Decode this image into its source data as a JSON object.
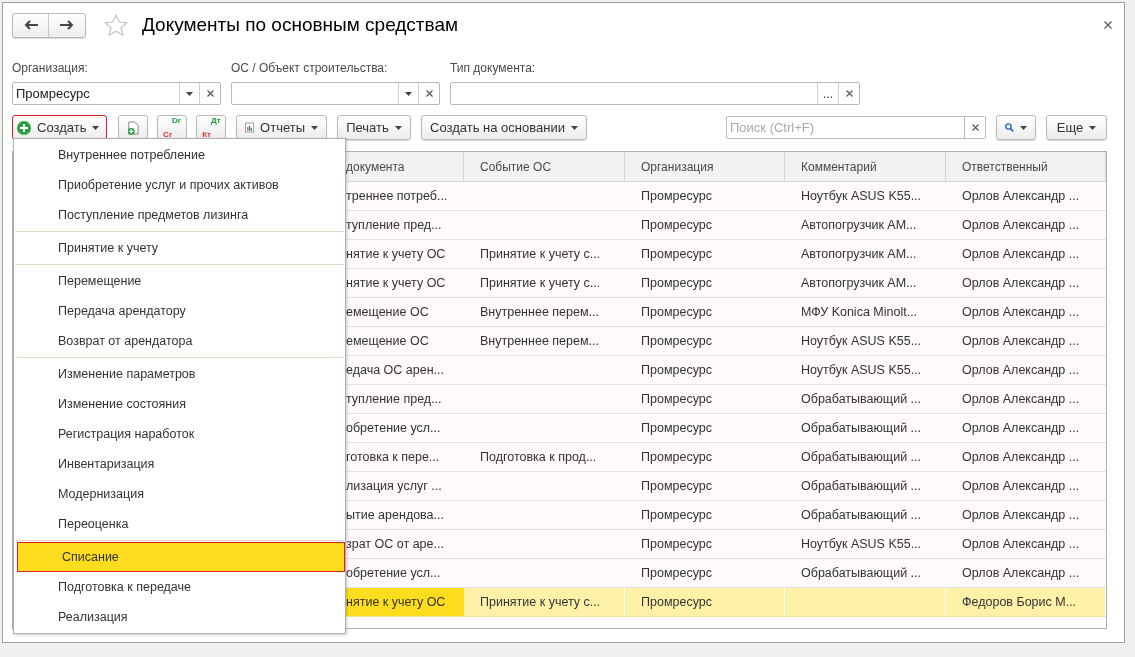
{
  "window": {
    "title": "Документы по основным средствам"
  },
  "filters": [
    {
      "label": "Организация:",
      "value": "Промресурс",
      "kind": "combo"
    },
    {
      "label": "ОС / Объект строительства:",
      "kind": "combo"
    },
    {
      "label": "Тип документа:",
      "kind": "select",
      "select_button": "..."
    }
  ],
  "toolbar": {
    "create": "Создать",
    "drcr": {
      "top": "Dr",
      "bottom": "Cr"
    },
    "dtkt": {
      "top": "Дт",
      "bottom": "Кт"
    },
    "reports": "Отчеты",
    "print": "Печать",
    "create_based": "Создать на основании",
    "search": {
      "placeholder": "Поиск (Ctrl+F)"
    },
    "more": "Еще"
  },
  "create_menu": [
    {
      "label": "Внутреннее потребление",
      "separator_before": false,
      "selected": false
    },
    {
      "label": "Приобретение услуг и прочих активов",
      "separator_before": false,
      "selected": false
    },
    {
      "label": "Поступление предметов лизинга",
      "separator_before": false,
      "selected": false
    },
    {
      "label": "Принятие к учету",
      "separator_before": true,
      "selected": false
    },
    {
      "label": "Перемещение",
      "separator_before": true,
      "selected": false
    },
    {
      "label": "Передача арендатору",
      "separator_before": false,
      "selected": false
    },
    {
      "label": "Возврат от арендатора",
      "separator_before": false,
      "selected": false
    },
    {
      "label": "Изменение параметров",
      "separator_before": true,
      "selected": false
    },
    {
      "label": "Изменение состояния",
      "separator_before": false,
      "selected": false
    },
    {
      "label": "Регистрация наработок",
      "separator_before": false,
      "selected": false
    },
    {
      "label": "Инвентаризация",
      "separator_before": false,
      "selected": false
    },
    {
      "label": "Модернизация",
      "separator_before": false,
      "selected": false
    },
    {
      "label": "Переоценка",
      "separator_before": false,
      "selected": false
    },
    {
      "label": "Списание",
      "separator_before": true,
      "selected": true
    },
    {
      "label": "Подготовка к передаче",
      "separator_before": false,
      "selected": false
    },
    {
      "label": "Реализация",
      "separator_before": false,
      "selected": false
    }
  ],
  "table": {
    "columns": [
      "документа",
      "Событие ОС",
      "Организация",
      "Комментарий",
      "Ответственный"
    ],
    "rows": [
      {
        "cells": [
          "треннее потреб...",
          "",
          "Промресурс",
          "Ноутбук ASUS K55...",
          "Орлов Александр ..."
        ],
        "selected": false
      },
      {
        "cells": [
          "тупление пред...",
          "",
          "Промресурс",
          "Автопогрузчик АМ...",
          "Орлов Александр ..."
        ],
        "selected": false
      },
      {
        "cells": [
          "нятие к учету ОС",
          "Принятие к учету с...",
          "Промресурс",
          "Автопогрузчик АМ...",
          "Орлов Александр ..."
        ],
        "selected": false
      },
      {
        "cells": [
          "нятие к учету ОС",
          "Принятие к учету с...",
          "Промресурс",
          "Автопогрузчик АМ...",
          "Орлов Александр ..."
        ],
        "selected": false
      },
      {
        "cells": [
          "емещение ОС",
          "Внутреннее перем...",
          "Промресурс",
          "МФУ Konica Minolt...",
          "Орлов Александр ..."
        ],
        "selected": false
      },
      {
        "cells": [
          "емещение ОС",
          "Внутреннее перем...",
          "Промресурс",
          "Ноутбук ASUS K55...",
          "Орлов Александр ..."
        ],
        "selected": false
      },
      {
        "cells": [
          "едача ОС арен...",
          "",
          "Промресурс",
          "Ноутбук ASUS K55...",
          "Орлов Александр ..."
        ],
        "selected": false
      },
      {
        "cells": [
          "тупление пред...",
          "",
          "Промресурс",
          "Обрабатывающий ...",
          "Орлов Александр ..."
        ],
        "selected": false
      },
      {
        "cells": [
          "обретение усл...",
          "",
          "Промресурс",
          "Обрабатывающий ...",
          "Орлов Александр ..."
        ],
        "selected": false
      },
      {
        "cells": [
          "готовка к пере...",
          "Подготовка к прод...",
          "Промресурс",
          "Обрабатывающий ...",
          "Орлов Александр ..."
        ],
        "selected": false
      },
      {
        "cells": [
          "лизация услуг ...",
          "",
          "Промресурс",
          "Обрабатывающий ...",
          "Орлов Александр ..."
        ],
        "selected": false
      },
      {
        "cells": [
          "ытие арендова...",
          "",
          "Промресурс",
          "Обрабатывающий ...",
          "Орлов Александр ..."
        ],
        "selected": false
      },
      {
        "cells": [
          "зрат ОС от аре...",
          "",
          "Промресурс",
          "Ноутбук ASUS K55...",
          "Орлов Александр ..."
        ],
        "selected": false
      },
      {
        "cells": [
          "обретение усл...",
          "",
          "Промресурс",
          "Обрабатывающий ...",
          "Орлов Александр ..."
        ],
        "selected": false
      },
      {
        "cells": [
          "нятие к учету ОС",
          "Принятие к учету с...",
          "Промресурс",
          "",
          "Федоров Борис М..."
        ],
        "selected": true
      }
    ]
  }
}
